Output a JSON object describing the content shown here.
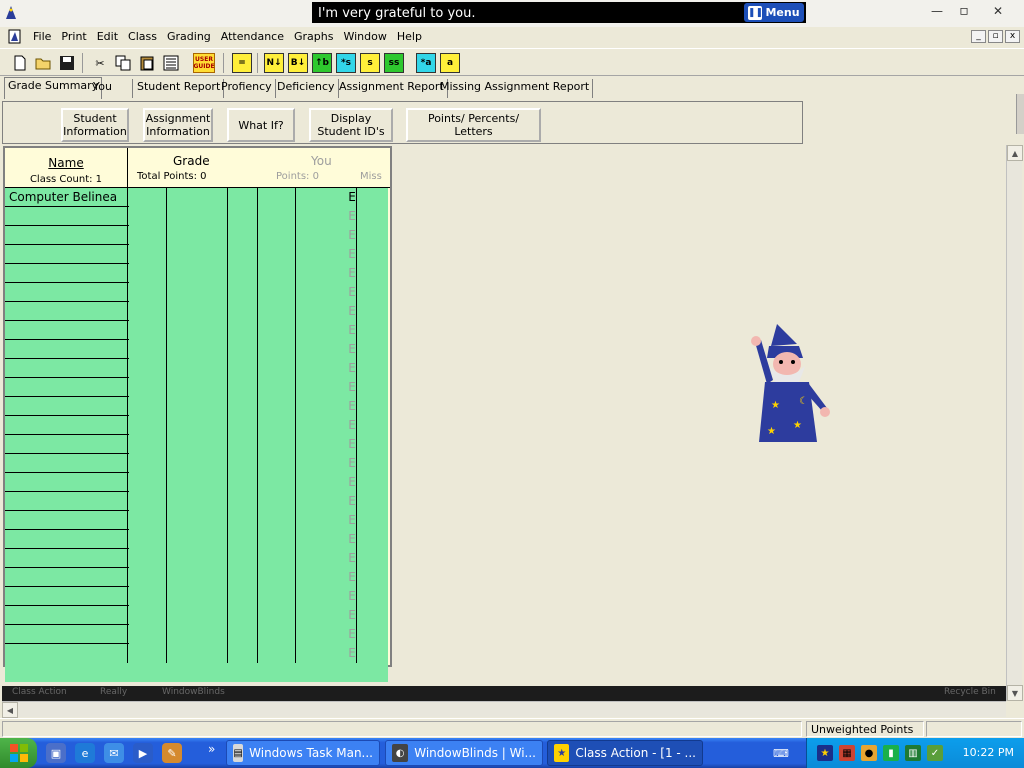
{
  "title_bar": {
    "speech": "I'm very grateful to you.",
    "menu_button": "Menu",
    "minimize": "—",
    "restore": "▫",
    "close": "✕"
  },
  "menubar": {
    "items": [
      "File",
      "Print",
      "Edit",
      "Class",
      "Grading",
      "Attendance",
      "Graphs",
      "Window",
      "Help"
    ]
  },
  "toolbar": {
    "user_guide": "USER GUIDE",
    "colored_buttons": [
      "=",
      "N↓",
      "B↓",
      "↑b",
      "*s",
      "s",
      "ss",
      "*a",
      "a"
    ]
  },
  "tabs": [
    "Grade Summary",
    "You",
    "Student Report",
    "Profiency",
    "Deficiency",
    "Assignment Report",
    "Missing Assignment Report"
  ],
  "panel_buttons": {
    "student_info": "Student Information",
    "assignment_info": "Assignment Information",
    "what_if": "What If?",
    "display_ids": "Display Student ID's",
    "points_percents": "Points/ Percents/ Letters"
  },
  "grid": {
    "name_header": "Name",
    "class_count": "Class Count: 1",
    "grade_header": "Grade",
    "total_points": "Total Points: 0",
    "assignment_header": "You",
    "assignment_points": "Points: 0",
    "miss_header": "Miss",
    "students": [
      "Computer Belinea"
    ],
    "grade_letter": "E"
  },
  "desktop_strip": {
    "left_text": "Class Action",
    "mid1": "Really",
    "mid2": "WindowBlinds",
    "right_text": "Recycle Bin"
  },
  "status": {
    "mode": "Unweighted Points"
  },
  "taskbar": {
    "tasks": [
      "Windows Task Man...",
      "WindowBlinds | Wi...",
      "Class Action - [1 - ..."
    ],
    "clock": "10:22 PM",
    "overflow": "»"
  }
}
